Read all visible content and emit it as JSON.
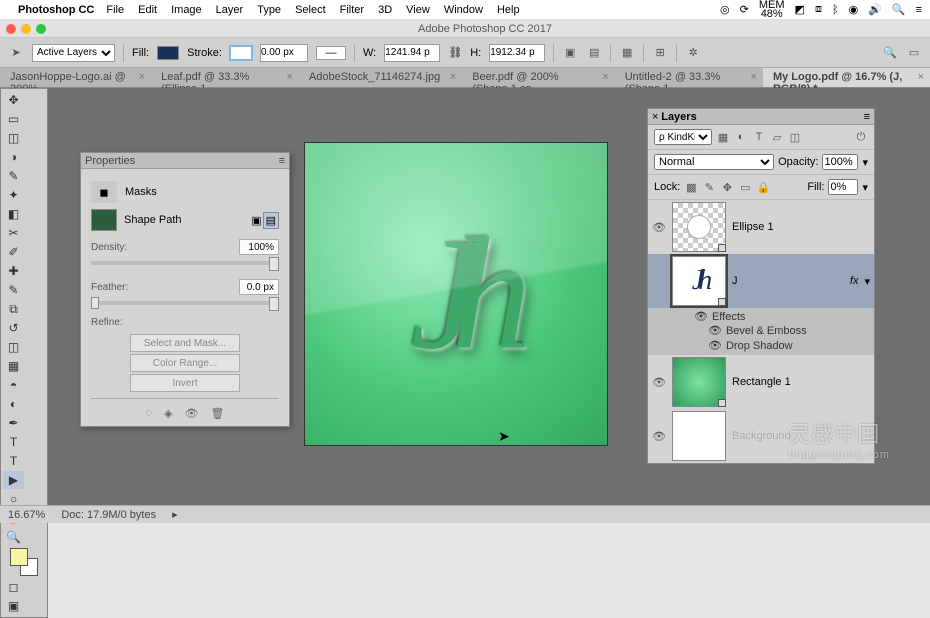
{
  "menubar": {
    "app": "Photoshop CC",
    "items": [
      "File",
      "Edit",
      "Image",
      "Layer",
      "Type",
      "Select",
      "Filter",
      "3D",
      "View",
      "Window",
      "Help"
    ],
    "mem_label": "MEM",
    "mem_pct": "48%"
  },
  "window": {
    "title": "Adobe Photoshop CC 2017"
  },
  "options": {
    "layer_select": "Active Layers",
    "fill_label": "Fill:",
    "fill_color": "#1a2f55",
    "stroke_label": "Stroke:",
    "stroke_val": "0.00 px",
    "w_label": "W:",
    "w_val": "1241.94 p",
    "h_label": "H:",
    "h_val": "1912.34 p"
  },
  "tabs": [
    {
      "label": "JasonHoppe-Logo.ai @ 200%..."
    },
    {
      "label": "Leaf.pdf @ 33.3% (Ellipse 1, ..."
    },
    {
      "label": "AdobeStock_71146274.jpg ..."
    },
    {
      "label": "Beer.pdf @ 200% (Shape 1 co..."
    },
    {
      "label": "Untitled-2 @ 33.3% (Shape 1..."
    },
    {
      "label": "My Logo.pdf @ 16.7% (J, RGB/8) *",
      "active": true
    }
  ],
  "canvas": {
    "logo_text": "Jh"
  },
  "properties": {
    "title": "Properties",
    "masks_label": "Masks",
    "shape_path_label": "Shape Path",
    "density_label": "Density:",
    "density_val": "100%",
    "feather_label": "Feather:",
    "feather_val": "0.0 px",
    "refine_label": "Refine:",
    "btn_select_mask": "Select and Mask...",
    "btn_color_range": "Color Range...",
    "btn_invert": "Invert"
  },
  "layers_panel": {
    "title": "Layers",
    "kind_label": "Kind",
    "blend_mode": "Normal",
    "opacity_label": "Opacity:",
    "opacity_val": "100%",
    "lock_label": "Lock:",
    "fill_label": "Fill:",
    "fill_val": "0%",
    "items": {
      "0": {
        "name": "Ellipse 1"
      },
      "1": {
        "name": "J",
        "fx": "fx"
      },
      "2": {
        "name": "Rectangle 1"
      },
      "3": {
        "name": "Background"
      }
    },
    "effects_label": "Effects",
    "effect_bevel": "Bevel & Emboss",
    "effect_shadow": "Drop Shadow"
  },
  "status": {
    "zoom": "16.67%",
    "doc": "Doc: 17.9M/0 bytes"
  },
  "watermark": {
    "cn": "灵感中国",
    "en": "lingganchina.com"
  }
}
